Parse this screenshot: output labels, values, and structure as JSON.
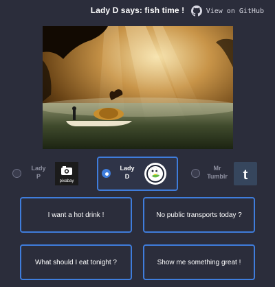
{
  "header": {
    "title": "Lady D says: fish time !",
    "github_label": "View on GitHub"
  },
  "personas": [
    {
      "name_line1": "Lady",
      "name_line2": "P",
      "logo": "pixabay-logo",
      "logo_text": "pixabay",
      "selected": false
    },
    {
      "name_line1": "Lady",
      "name_line2": "D",
      "logo": "duckduckgo-logo",
      "selected": true
    },
    {
      "name_line1": "Mr",
      "name_line2": "Tumblr",
      "logo": "tumblr-logo",
      "logo_text": "t",
      "selected": false
    }
  ],
  "prompts": [
    {
      "label": "I want a hot drink !"
    },
    {
      "label": "No public transports today ?"
    },
    {
      "label": "What should I eat tonight ?"
    },
    {
      "label": "Show me something great !"
    }
  ],
  "colors": {
    "background": "#2b2d3b",
    "accent": "#3f7ddc"
  }
}
